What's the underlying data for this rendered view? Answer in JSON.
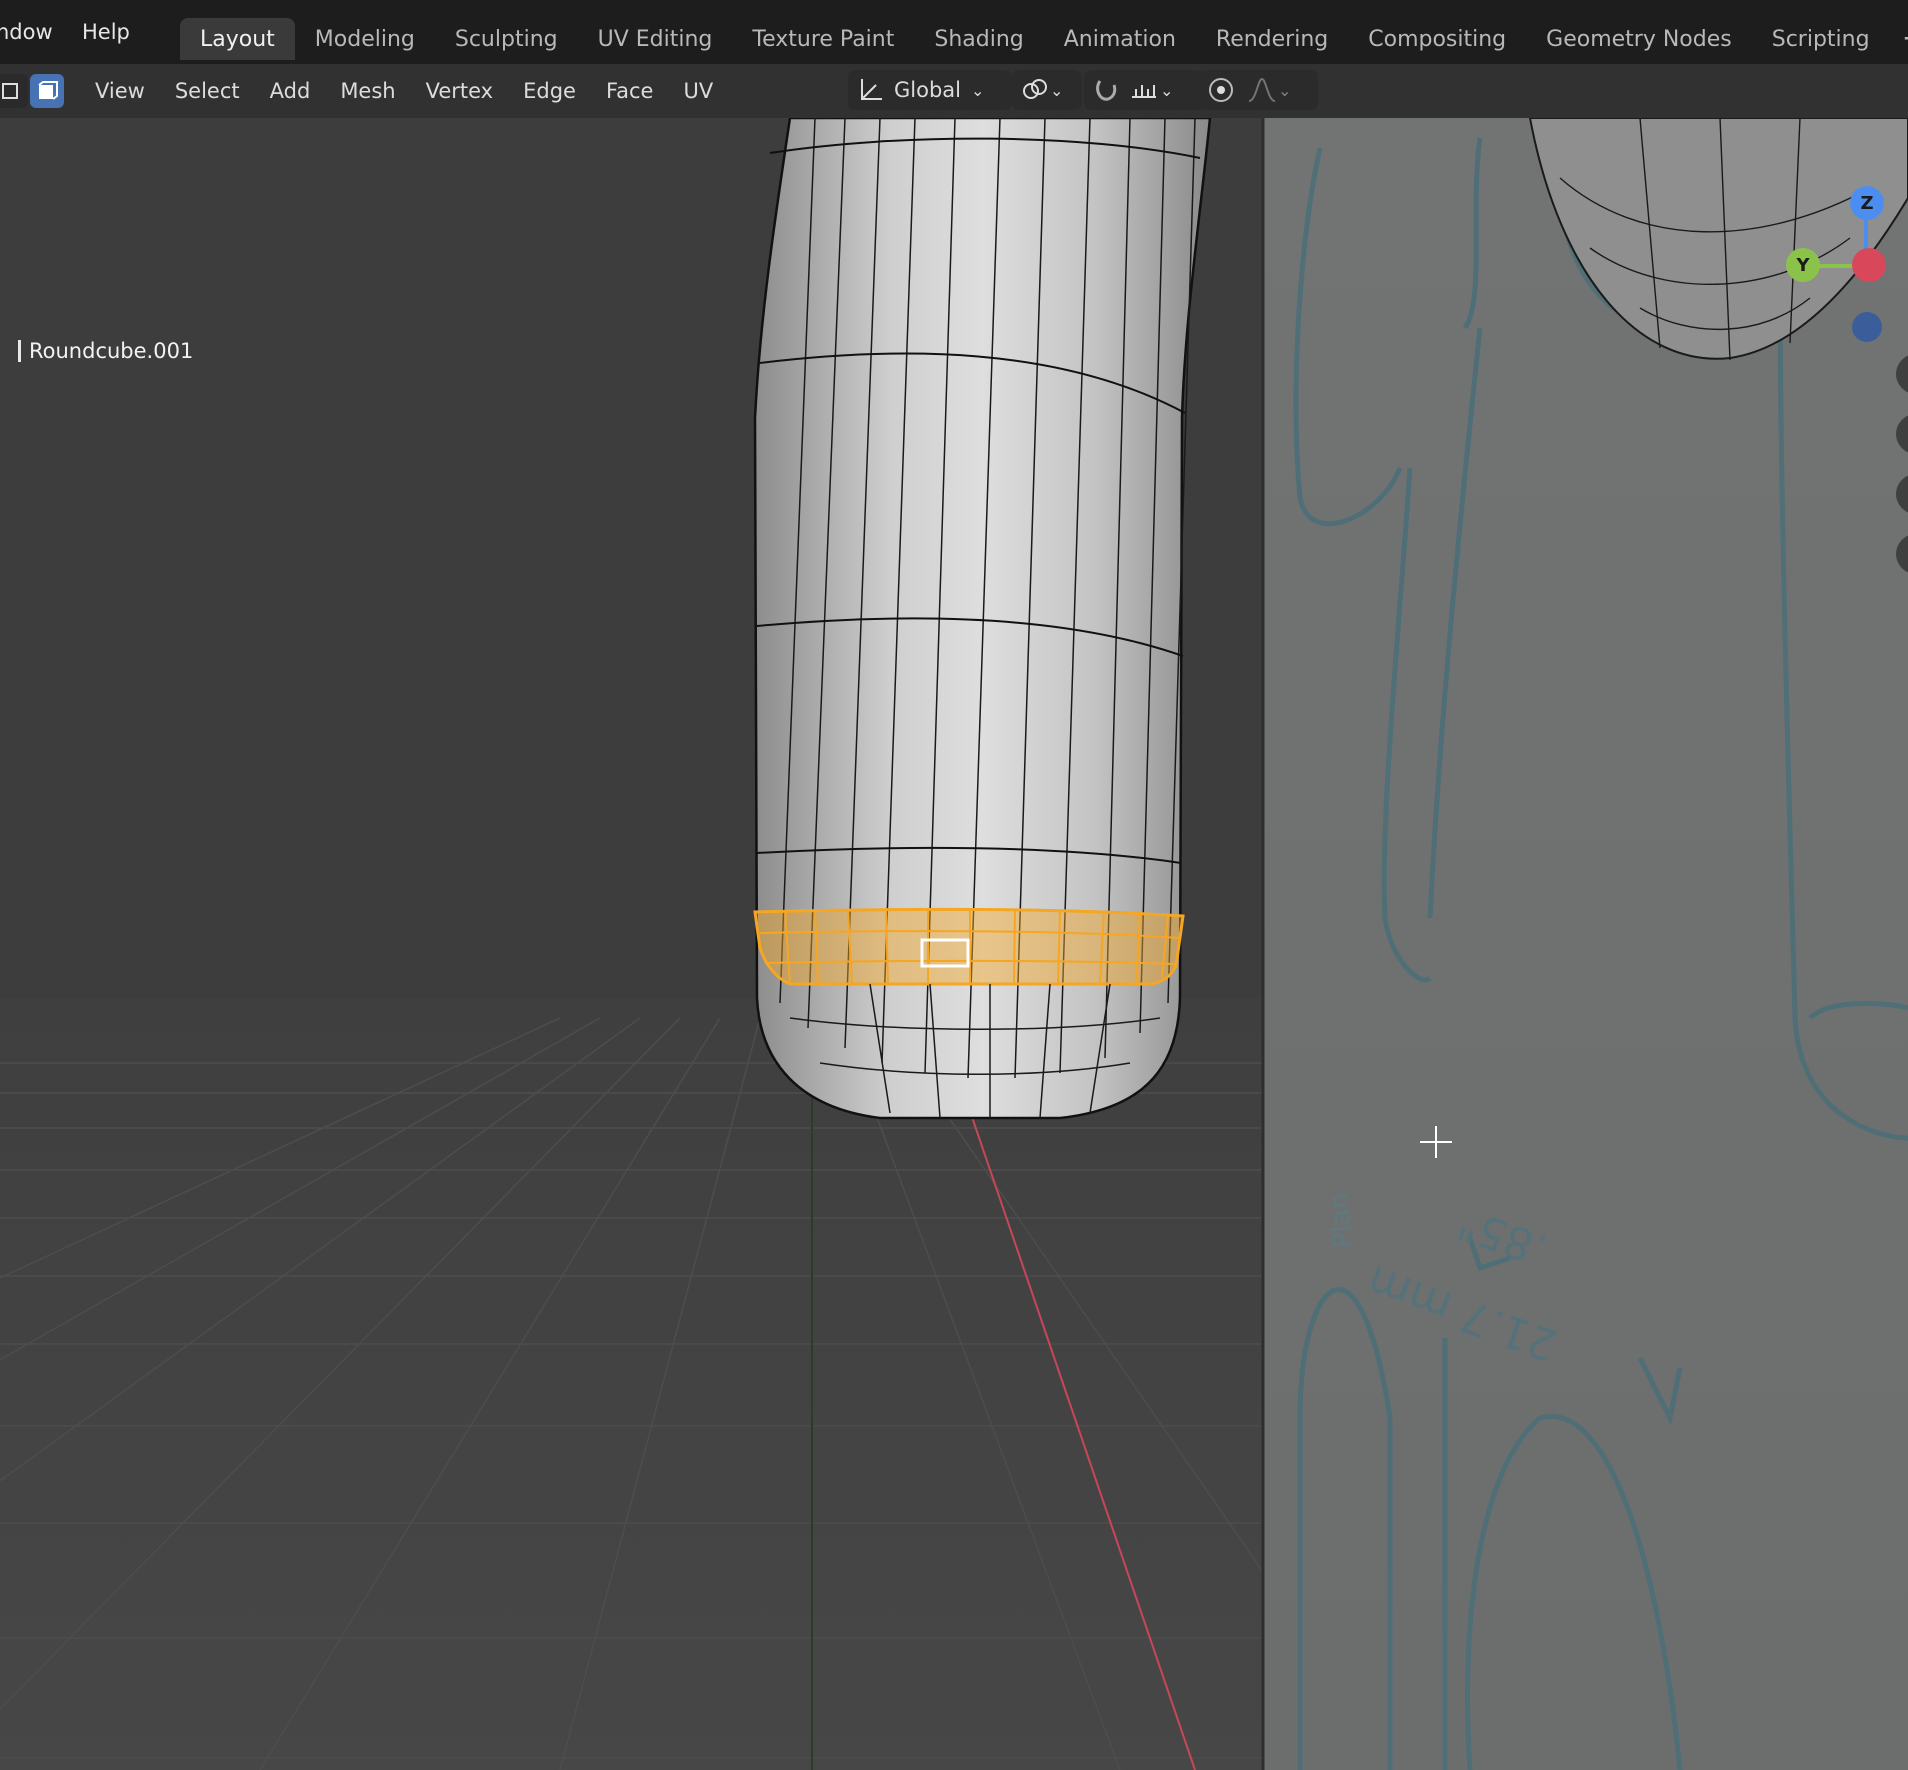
{
  "top_menu": {
    "window": "ndow",
    "help": "Help"
  },
  "workspace_tabs": [
    {
      "label": "Layout",
      "active": true
    },
    {
      "label": "Modeling",
      "active": false
    },
    {
      "label": "Sculpting",
      "active": false
    },
    {
      "label": "UV Editing",
      "active": false
    },
    {
      "label": "Texture Paint",
      "active": false
    },
    {
      "label": "Shading",
      "active": false
    },
    {
      "label": "Animation",
      "active": false
    },
    {
      "label": "Rendering",
      "active": false
    },
    {
      "label": "Compositing",
      "active": false
    },
    {
      "label": "Geometry Nodes",
      "active": false
    },
    {
      "label": "Scripting",
      "active": false
    }
  ],
  "workspace_add_glyph": "+",
  "header_menu": [
    "View",
    "Select",
    "Add",
    "Mesh",
    "Vertex",
    "Edge",
    "Face",
    "UV"
  ],
  "transform_orientation": "Global",
  "object_name": "Roundcube.001",
  "gizmo": {
    "z": "Z",
    "y": "Y"
  },
  "colors": {
    "selection": "#f5a623",
    "x_axis": "#d8485a",
    "y_axis": "#8bc34a",
    "z_axis": "#4c8ef0"
  }
}
